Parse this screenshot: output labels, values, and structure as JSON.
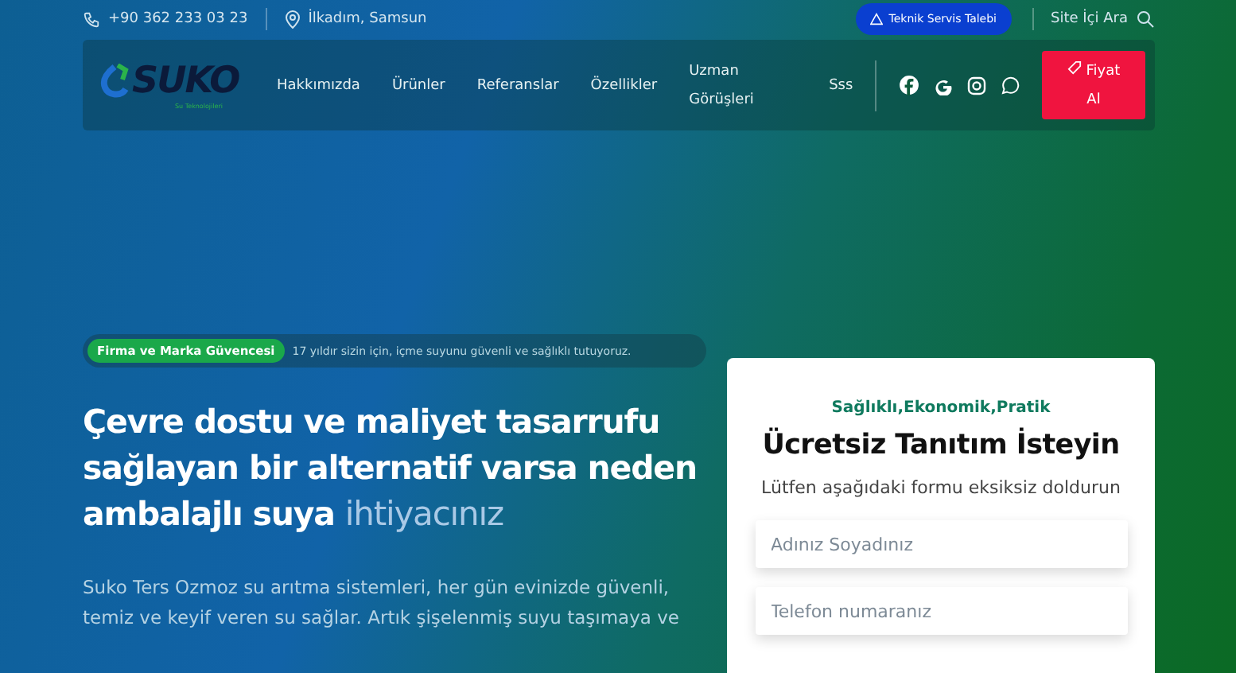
{
  "topbar": {
    "phone": "+90 362 233 03 23",
    "location": "İlkadım, Samsun",
    "service_button": "Teknik Servis Talebi",
    "search_label": "Site İçi Ara"
  },
  "logo": {
    "name": "SUKO",
    "tagline": "Su Teknolojileri"
  },
  "nav": {
    "items": [
      {
        "label": "Hakkımızda"
      },
      {
        "label": "Ürünler"
      },
      {
        "label": "Referanslar"
      },
      {
        "label": "Özellikler"
      },
      {
        "label": "Uzman Görüşleri"
      },
      {
        "label": "Sss"
      }
    ],
    "social": [
      {
        "kind": "facebook"
      },
      {
        "kind": "google"
      },
      {
        "kind": "instagram"
      },
      {
        "kind": "whatsapp"
      }
    ],
    "cta": "Fiyat Al"
  },
  "hero": {
    "badge": "Firma ve Marka Güvencesi",
    "badge_text": "17 yıldır sizin için, içme suyunu güvenli ve sağlıklı tutuyoruz.",
    "heading": "Çevre dostu ve maliyet tasarrufu sağlayan bir alternatif varsa neden ambalajlı suya",
    "heading_tail": "ihtiyacınız",
    "paragraph": "Suko Ters Ozmoz su arıtma sistemleri, her gün evinizde güvenli, temiz ve keyif veren su sağlar. Artık şişelenmiş suyu taşımaya ve"
  },
  "form": {
    "eyebrow": "Sağlıklı,Ekonomik,Pratik",
    "title": "Ücretsiz Tanıtım İsteyin",
    "subtitle": "Lütfen aşağıdaki formu eksiksiz doldurun",
    "fields": [
      {
        "placeholder": "Adınız Soyadınız"
      },
      {
        "placeholder": "Telefon numaranız"
      }
    ]
  }
}
